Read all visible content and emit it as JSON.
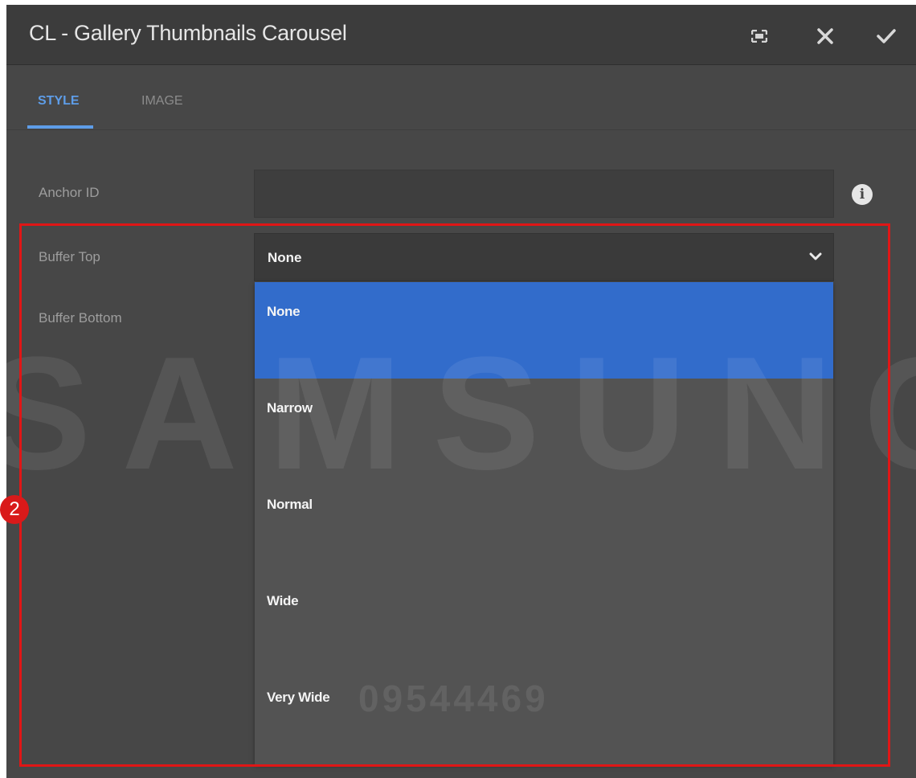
{
  "dialog": {
    "title": "CL - Gallery Thumbnails Carousel",
    "actions": {
      "fullscreen_icon": "fullscreen-icon",
      "close_icon": "close-icon",
      "confirm_icon": "check-icon"
    }
  },
  "tabs": [
    {
      "label": "STYLE",
      "active": true
    },
    {
      "label": "IMAGE",
      "active": false
    }
  ],
  "form": {
    "anchor_id": {
      "label": "Anchor ID",
      "value": "",
      "info_icon": "info-icon"
    },
    "buffer_top": {
      "label": "Buffer Top",
      "value": "None"
    },
    "buffer_bottom": {
      "label": "Buffer Bottom"
    }
  },
  "dropdown": {
    "options": [
      "None",
      "Narrow",
      "Normal",
      "Wide",
      "Very Wide"
    ],
    "selected": "None"
  },
  "annotation": {
    "marker": "2"
  },
  "watermark": {
    "brand": "SAMSUNG",
    "number": "09544469"
  },
  "colors": {
    "accent": "#5e9de8",
    "selected": "#326ccb",
    "highlight": "#e01616"
  }
}
